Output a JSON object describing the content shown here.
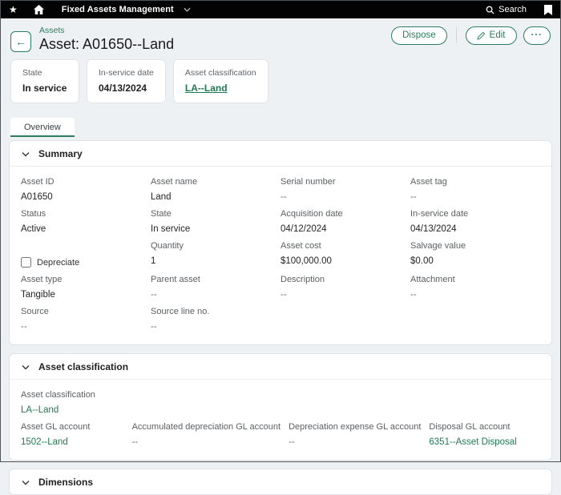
{
  "colors": {
    "accent": "#2a7e5e",
    "link": "#1e7a52",
    "topbar_bg": "#030303"
  },
  "topbar": {
    "app_title": "Fixed Assets Management",
    "search_label": "Search"
  },
  "header": {
    "breadcrumb": "Assets",
    "title": "Asset: A01650--Land",
    "buttons": {
      "dispose": "Dispose",
      "edit": "Edit",
      "more": "···"
    }
  },
  "info_cards": [
    {
      "label": "State",
      "value": "In service"
    },
    {
      "label": "In-service date",
      "value": "04/13/2024"
    },
    {
      "label": "Asset classification",
      "value": "LA--Land"
    }
  ],
  "tabs": [
    {
      "label": "Overview"
    }
  ],
  "summary": {
    "title": "Summary",
    "depreciate_label": "Depreciate",
    "fields": [
      {
        "label": "Asset ID",
        "value": "A01650"
      },
      {
        "label": "Asset name",
        "value": "Land"
      },
      {
        "label": "Serial number",
        "value": "--"
      },
      {
        "label": "Asset tag",
        "value": "--"
      },
      {
        "label": "Status",
        "value": "Active"
      },
      {
        "label": "State",
        "value": "In service"
      },
      {
        "label": "Acquisition date",
        "value": "04/12/2024"
      },
      {
        "label": "In-service date",
        "value": "04/13/2024"
      },
      {
        "label": "Quantity",
        "value": "1"
      },
      {
        "label": "Asset cost",
        "value": "$100,000.00"
      },
      {
        "label": "Salvage value",
        "value": "$0.00"
      },
      {
        "label": "Asset type",
        "value": "Tangible"
      },
      {
        "label": "Parent asset",
        "value": "--"
      },
      {
        "label": "Description",
        "value": "--"
      },
      {
        "label": "Attachment",
        "value": "--"
      },
      {
        "label": "Source",
        "value": "--"
      },
      {
        "label": "Source line no.",
        "value": "--"
      }
    ]
  },
  "classification": {
    "title": "Asset classification",
    "primary": {
      "label": "Asset classification",
      "value": "LA--Land"
    },
    "fields": [
      {
        "label": "Asset GL account",
        "value": "1502--Land"
      },
      {
        "label": "Accumulated depreciation GL account",
        "value": "--"
      },
      {
        "label": "Depreciation expense GL account",
        "value": "--"
      },
      {
        "label": "Disposal GL account",
        "value": "6351--Asset Disposal"
      }
    ]
  },
  "dimensions": {
    "title": "Dimensions"
  }
}
